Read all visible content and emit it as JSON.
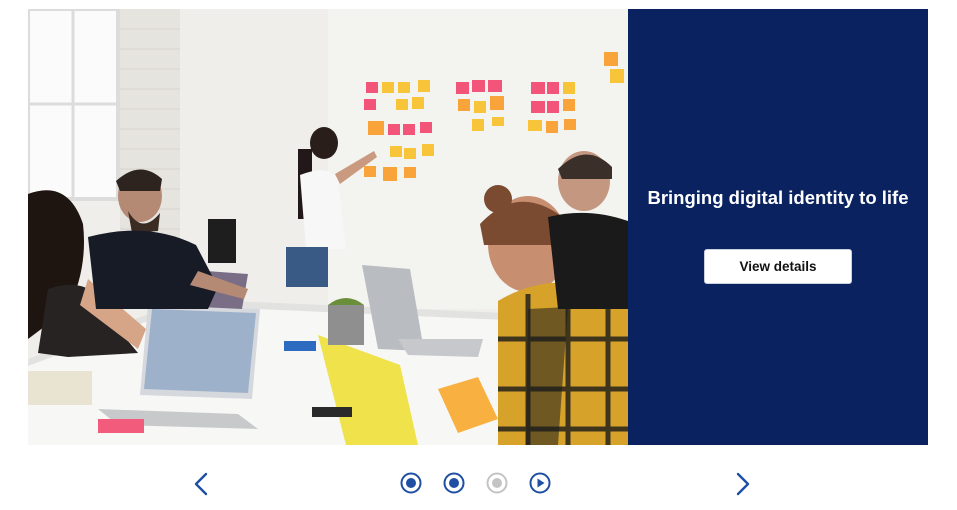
{
  "slide": {
    "image_alt": "Team collaborating in an office meeting with sticky notes on the wall",
    "title": "Bringing digital identity to life",
    "button_label": "View details"
  },
  "controls": {
    "prev_icon": "chevron-left-icon",
    "next_icon": "chevron-right-icon",
    "indicators": [
      {
        "state": "active"
      },
      {
        "state": "active"
      },
      {
        "state": "inactive"
      },
      {
        "state": "play"
      }
    ]
  },
  "colors": {
    "panel": "#0a2360",
    "accent": "#1f4fa3",
    "inactive": "#c4c4c4"
  }
}
